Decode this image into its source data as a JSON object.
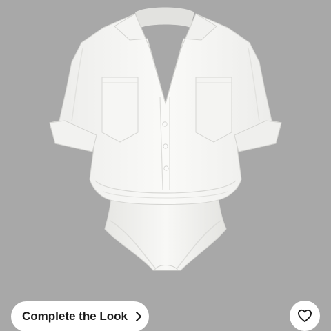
{
  "product": {
    "image_alt": "White short-sleeve button-front bodysuit with chest pockets and cuffed sleeves",
    "background_color": "#a8a8a8",
    "garment_color": "#f7f7f5"
  },
  "actions": {
    "complete_look_label": "Complete the Look",
    "complete_look_icon": "chevron-right-icon",
    "wishlist_icon": "heart-outline-icon"
  }
}
